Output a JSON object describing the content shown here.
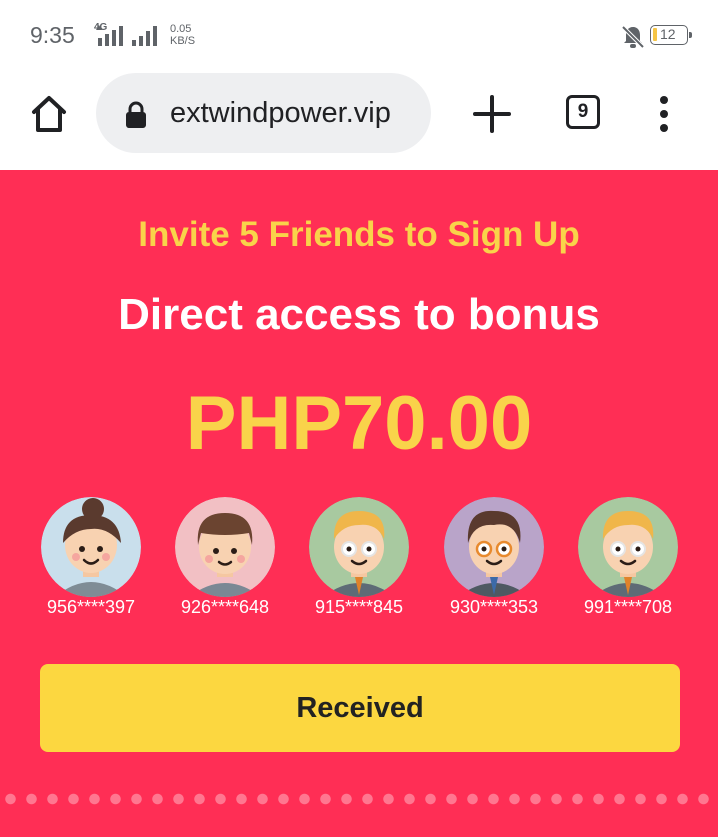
{
  "status_bar": {
    "time": "9:35",
    "network_type": "4G",
    "speed_value": "0.05",
    "speed_unit": "KB/S",
    "battery": "12",
    "colors": {
      "battery_fill": "#f6c545"
    }
  },
  "toolbar": {
    "url": "extwindpower.vip",
    "tab_count": "9",
    "icons": [
      "home-icon",
      "lock-icon",
      "plus-icon",
      "tab-switcher-icon",
      "more-vert-icon"
    ]
  },
  "page": {
    "headline": "Invite 5 Friends to Sign Up",
    "subtitle": "Direct access to bonus",
    "amount": "PHP70.00",
    "friends": [
      {
        "phone": "956****397",
        "avatar": "woman-bun-avatar"
      },
      {
        "phone": "926****648",
        "avatar": "boy-avatar"
      },
      {
        "phone": "915****845",
        "avatar": "blond-glasses-avatar"
      },
      {
        "phone": "930****353",
        "avatar": "brown-hair-glasses-avatar"
      },
      {
        "phone": "991****708",
        "avatar": "blond-glasses-avatar"
      }
    ],
    "button_label": "Received",
    "colors": {
      "background": "#ff2e55",
      "accent": "#f9d34a",
      "button": "#fcd740"
    }
  }
}
